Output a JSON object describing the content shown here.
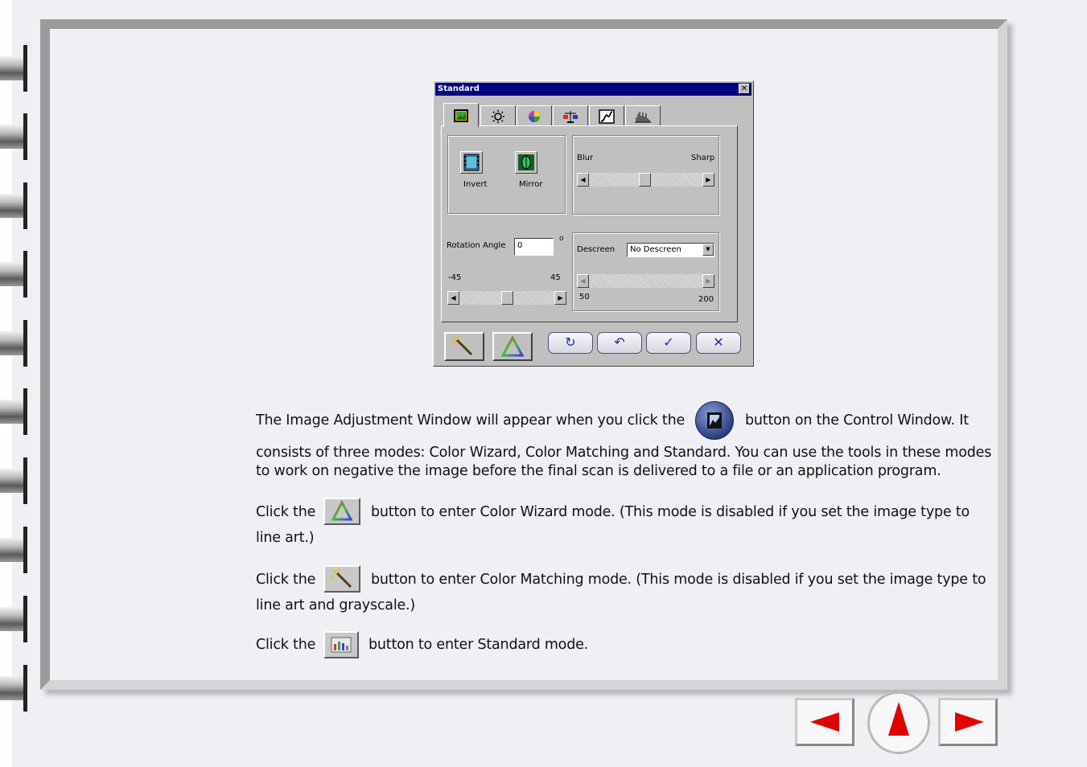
{
  "dialog": {
    "title": "Standard",
    "close_glyph": "✕",
    "tabs": [
      {
        "icon": "image-adjust-icon"
      },
      {
        "icon": "brightness-icon"
      },
      {
        "icon": "color-wheel-icon"
      },
      {
        "icon": "balance-icon"
      },
      {
        "icon": "curve-icon"
      },
      {
        "icon": "histogram-icon"
      }
    ],
    "invert_label": "Invert",
    "mirror_label": "Mirror",
    "sharpness": {
      "left_label": "Blur",
      "right_label": "Sharp"
    },
    "rotation": {
      "label": "Rotation Angle",
      "value": "0",
      "degree": "o",
      "min_label": "-45",
      "max_label": "45"
    },
    "descreen": {
      "label": "Descreen",
      "selected": "No Descreen",
      "min_label": "50",
      "max_label": "200"
    }
  },
  "content": {
    "p1_a": "The Image Adjustment Window will appear when you click the",
    "p1_b": "button on the Control Window. It",
    "p1_c": "consists of three modes: Color Wizard, Color Matching and Standard. You can use the tools in these modes",
    "p1_d": "to work on negative the image before the final scan is delivered to a file or an application program.",
    "click_the": "Click the",
    "p2_a": "button to enter Color Wizard mode. (This mode is disabled if you set the image type to",
    "p2_b": "line art.)",
    "p3_a": "button to enter Color Matching mode. (This mode is disabled if you set the image type to",
    "p3_b": "line art and grayscale.)",
    "p4_a": "button to enter Standard mode."
  },
  "colors": {
    "title_bar": "#000080",
    "nav_arrow": "#e00000",
    "dialog_face": "#c0c0c0"
  }
}
